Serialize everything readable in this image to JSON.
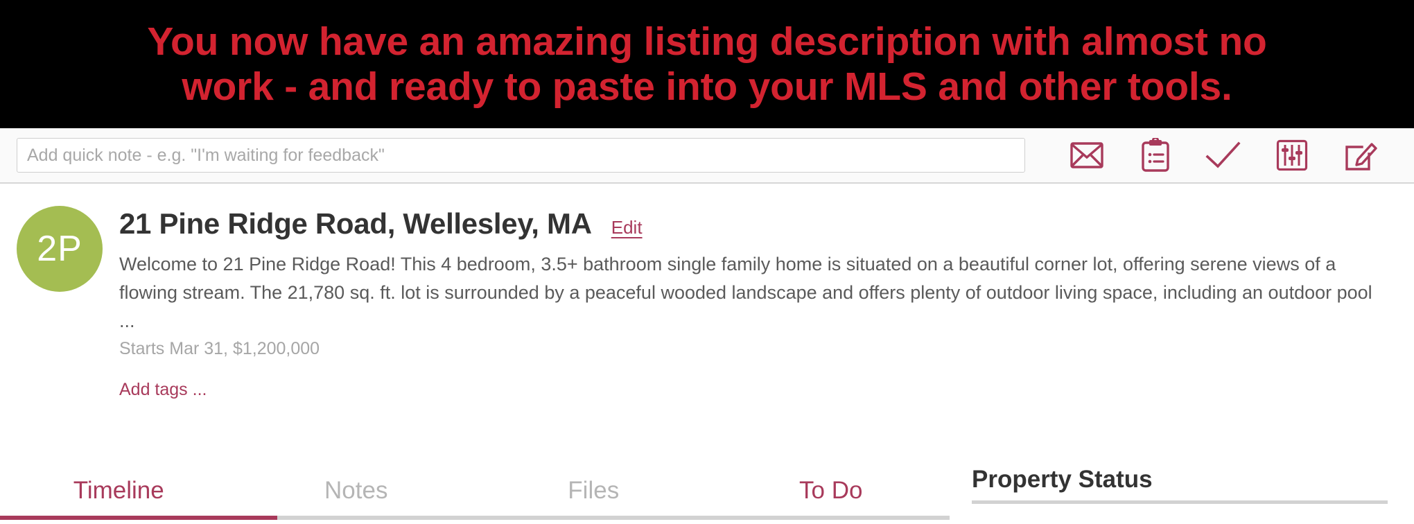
{
  "banner": {
    "line1": "You now have an amazing listing description with almost no",
    "line2": "work - and ready to paste into your MLS and other tools.",
    "background": "#000000",
    "text_color": "#d32330"
  },
  "toolbar": {
    "note_placeholder": "Add quick note - e.g. \"I'm waiting for feedback\"",
    "note_value": "",
    "icons": [
      {
        "name": "email-icon",
        "label": "Email"
      },
      {
        "name": "clipboard-list-icon",
        "label": "Notes"
      },
      {
        "name": "checkmark-icon",
        "label": "Complete"
      },
      {
        "name": "sliders-icon",
        "label": "Settings"
      },
      {
        "name": "compose-icon",
        "label": "Compose"
      }
    ],
    "icon_color": "#a83a5b"
  },
  "record": {
    "avatar_initials": "2P",
    "avatar_color": "#a4bd52",
    "title": "21 Pine Ridge Road, Wellesley, MA",
    "edit_label": "Edit",
    "description": "Welcome to 21 Pine Ridge Road! This 4 bedroom, 3.5+ bathroom single family home is situated on a beautiful corner lot, offering serene views of a flowing stream. The 21,780 sq. ft. lot is surrounded by a peaceful wooded landscape and offers plenty of outdoor living space, including an outdoor pool ...",
    "meta": "Starts Mar 31, $1,200,000",
    "add_tags_label": "Add tags ...",
    "accent_color": "#a83a5b"
  },
  "tabs": [
    {
      "label": "Timeline",
      "state": "active"
    },
    {
      "label": "Notes",
      "state": "muted"
    },
    {
      "label": "Files",
      "state": "muted"
    },
    {
      "label": "To Do",
      "state": "accent"
    }
  ],
  "side_panel": {
    "title": "Property Status"
  }
}
